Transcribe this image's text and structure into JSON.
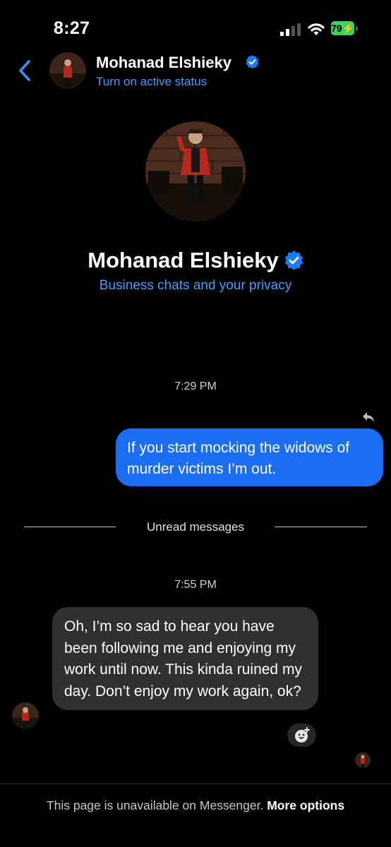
{
  "status_bar": {
    "time": "8:27",
    "battery": "79"
  },
  "header": {
    "name": "Mohanad Elshieky",
    "status": "Turn on active status"
  },
  "profile": {
    "name": "Mohanad Elshieky",
    "link": "Business chats and your privacy"
  },
  "messages": {
    "timestamp_1": "7:29 PM",
    "outgoing_text": "If you start mocking the widows of murder victims I’m out.",
    "unread_label": "Unread messages",
    "timestamp_2": "7:55 PM",
    "incoming_text": "Oh, I’m so sad to hear you have been following me and enjoying my work until now. This kinda ruined my day. Don’t enjoy my work again, ok?"
  },
  "footer": {
    "text": "This page is unavailable on Messenger.",
    "link": "More options"
  },
  "colors": {
    "accent": "#4b9cf4",
    "outgoing_bubble": "#1b6df4",
    "incoming_bubble": "#303030",
    "battery": "#3bd15c"
  }
}
